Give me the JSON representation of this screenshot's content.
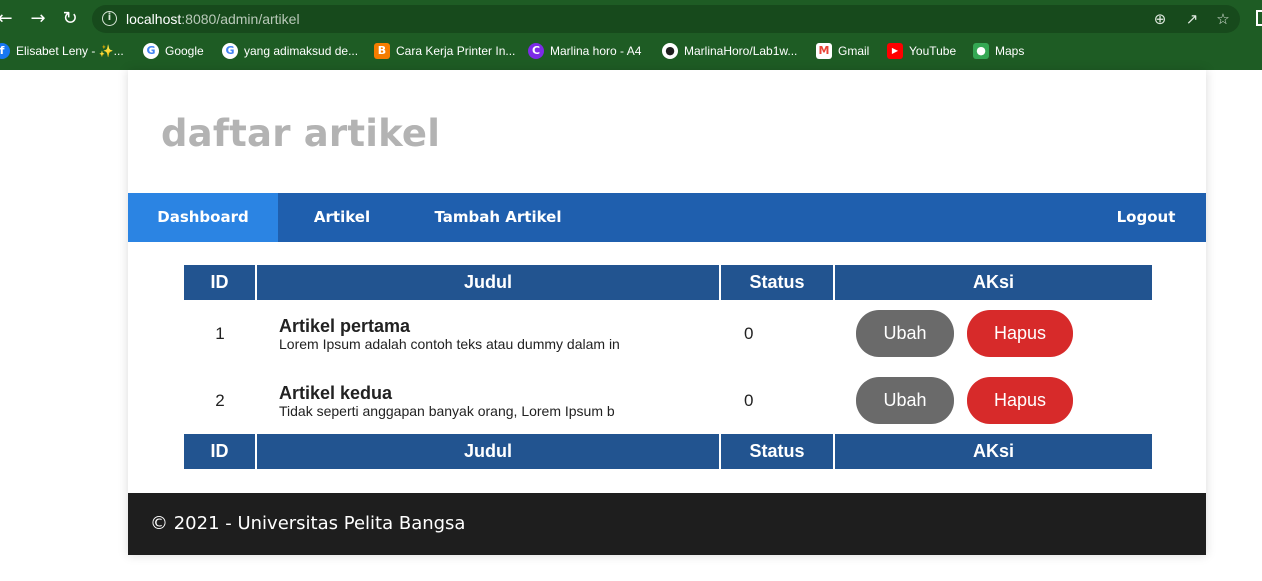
{
  "browser": {
    "url_host": "localhost",
    "url_port": ":8080",
    "url_path": "/admin/artikel",
    "nav_icons": {
      "back": "arrow-left-icon",
      "forward": "arrow-right-icon",
      "reload": "reload-icon"
    },
    "omnibox_icons": [
      "zoom-icon",
      "share-icon",
      "star-icon"
    ],
    "bookmarks": [
      {
        "label": "Elisabet Leny - ✨...",
        "icon": "facebook-icon",
        "color": "#1877f2"
      },
      {
        "label": "Google",
        "icon": "google-icon",
        "color": "#ffffff"
      },
      {
        "label": "yang adimaksud de...",
        "icon": "google-icon",
        "color": "#ffffff"
      },
      {
        "label": "Cara Kerja Printer In...",
        "icon": "blogger-icon",
        "color": "#f57d00"
      },
      {
        "label": "Marlina horo - A4",
        "icon": "canva-icon",
        "color": "#7d2ae8"
      },
      {
        "label": "MarlinaHoro/Lab1w...",
        "icon": "github-icon",
        "color": "#ffffff"
      },
      {
        "label": "Gmail",
        "icon": "gmail-icon",
        "color": "#ea4335"
      },
      {
        "label": "YouTube",
        "icon": "youtube-icon",
        "color": "#ff0000"
      },
      {
        "label": "Maps",
        "icon": "maps-icon",
        "color": "#34a853"
      }
    ]
  },
  "header": {
    "title": "daftar artikel"
  },
  "nav": {
    "items": [
      {
        "label": "Dashboard",
        "active": true
      },
      {
        "label": "Artikel",
        "active": false
      },
      {
        "label": "Tambah Artikel",
        "active": false
      }
    ],
    "logout": "Logout"
  },
  "table": {
    "headers": [
      "ID",
      "Judul",
      "Status",
      "AKsi"
    ],
    "rows": [
      {
        "id": "1",
        "title": "Artikel pertama",
        "excerpt": "Lorem Ipsum adalah contoh teks atau dummy dalam in",
        "status": "0",
        "edit": "Ubah",
        "delete": "Hapus"
      },
      {
        "id": "2",
        "title": "Artikel kedua",
        "excerpt": "Tidak seperti anggapan banyak orang, Lorem Ipsum b",
        "status": "0",
        "edit": "Ubah",
        "delete": "Hapus"
      }
    ],
    "footer_headers": [
      "ID",
      "Judul",
      "Status",
      "AKsi"
    ]
  },
  "footer": {
    "text": "© 2021 - Universitas Pelita Bangsa"
  },
  "colors": {
    "chrome": "#1e5c24",
    "navbar": "#1f5fae",
    "nav_active": "#2b84e3",
    "table_header": "#225490",
    "btn_edit": "#6a6a6a",
    "btn_delete": "#d72a2a",
    "footer": "#1e1e1e"
  }
}
